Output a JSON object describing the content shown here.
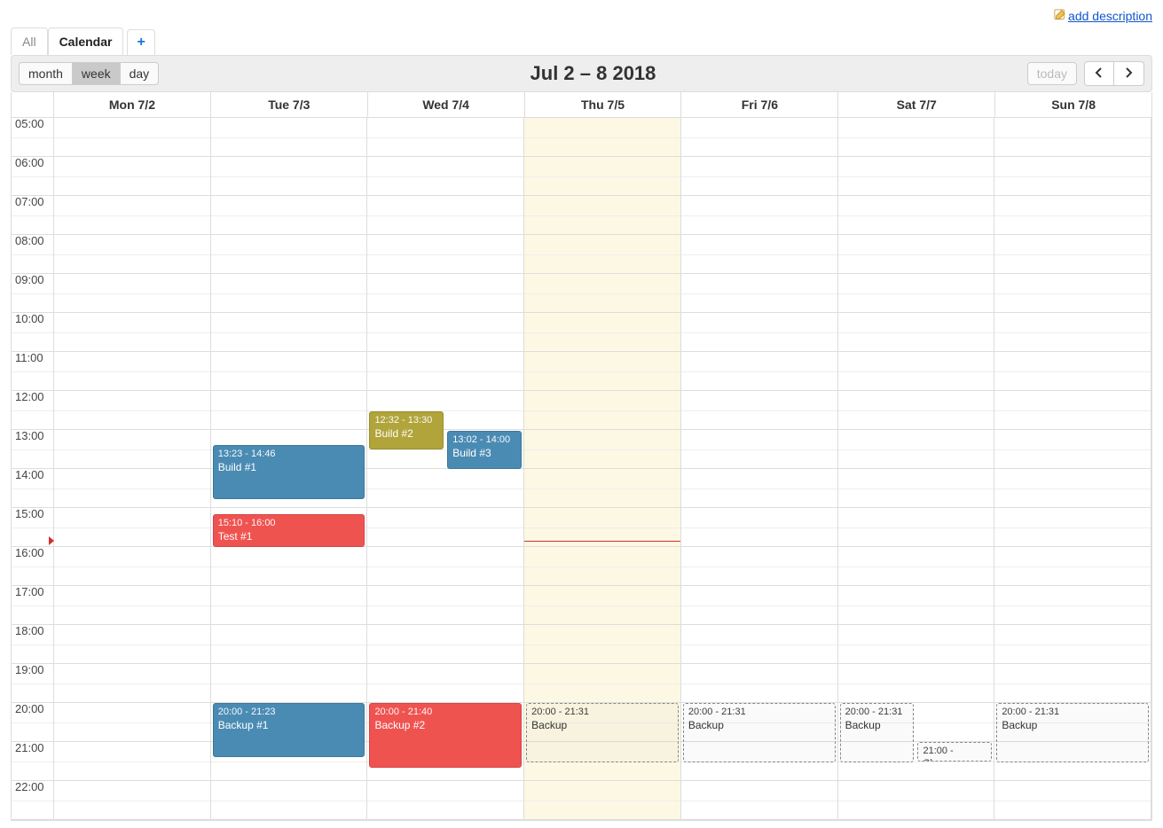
{
  "topbar": {
    "add_description": "add description"
  },
  "tabs": {
    "all": "All",
    "calendar": "Calendar",
    "add": "+"
  },
  "toolbar": {
    "views": {
      "month": "month",
      "week": "week",
      "day": "day"
    },
    "today": "today"
  },
  "title": "Jul 2 – 8 2018",
  "days": [
    {
      "label": "Mon 7/2",
      "today": false
    },
    {
      "label": "Tue 7/3",
      "today": false
    },
    {
      "label": "Wed 7/4",
      "today": false
    },
    {
      "label": "Thu 7/5",
      "today": true
    },
    {
      "label": "Fri 7/6",
      "today": false
    },
    {
      "label": "Sat 7/7",
      "today": false
    },
    {
      "label": "Sun 7/8",
      "today": false
    }
  ],
  "hours": [
    "05:00",
    "06:00",
    "07:00",
    "08:00",
    "09:00",
    "10:00",
    "11:00",
    "12:00",
    "13:00",
    "14:00",
    "15:00",
    "16:00",
    "17:00",
    "18:00",
    "19:00",
    "20:00",
    "21:00",
    "22:00"
  ],
  "now": {
    "dayIndex": 3,
    "hour": 15,
    "minute": 50
  },
  "events": [
    {
      "day": 1,
      "start": "13:23",
      "end": "14:46",
      "time": "13:23 - 14:46",
      "title": "Build #1",
      "style": "blue",
      "col": 0,
      "cols": 1
    },
    {
      "day": 1,
      "start": "15:10",
      "end": "16:00",
      "time": "15:10 - 16:00",
      "title": "Test #1",
      "style": "red",
      "col": 0,
      "cols": 1
    },
    {
      "day": 1,
      "start": "20:00",
      "end": "21:23",
      "time": "20:00 - 21:23",
      "title": "Backup #1",
      "style": "blue",
      "col": 0,
      "cols": 1
    },
    {
      "day": 2,
      "start": "12:32",
      "end": "13:30",
      "time": "12:32 - 13:30",
      "title": "Build #2",
      "style": "olive",
      "col": 0,
      "cols": 2,
      "span": 1
    },
    {
      "day": 2,
      "start": "13:02",
      "end": "14:00",
      "time": "13:02 - 14:00",
      "title": "Build #3",
      "style": "blue",
      "col": 1,
      "cols": 2,
      "span": 1
    },
    {
      "day": 2,
      "start": "20:00",
      "end": "21:40",
      "time": "20:00 - 21:40",
      "title": "Backup #2",
      "style": "red",
      "col": 0,
      "cols": 1
    },
    {
      "day": 3,
      "start": "20:00",
      "end": "21:31",
      "time": "20:00 - 21:31",
      "title": "Backup",
      "style": "ghost",
      "col": 0,
      "cols": 1
    },
    {
      "day": 4,
      "start": "20:00",
      "end": "21:31",
      "time": "20:00 - 21:31",
      "title": "Backup",
      "style": "ghost",
      "col": 0,
      "cols": 1
    },
    {
      "day": 5,
      "start": "20:00",
      "end": "21:31",
      "time": "20:00 - 21:31",
      "title": "Backup",
      "style": "ghost",
      "col": 0,
      "cols": 2,
      "span": 1
    },
    {
      "day": 5,
      "start": "21:00",
      "end": "21:30",
      "time": "21:00 - ",
      "title": "Cleanup",
      "style": "ghost",
      "col": 1,
      "cols": 2,
      "span": 1,
      "inline": true
    },
    {
      "day": 6,
      "start": "20:00",
      "end": "21:31",
      "time": "20:00 - 21:31",
      "title": "Backup",
      "style": "ghost",
      "col": 0,
      "cols": 1
    }
  ]
}
